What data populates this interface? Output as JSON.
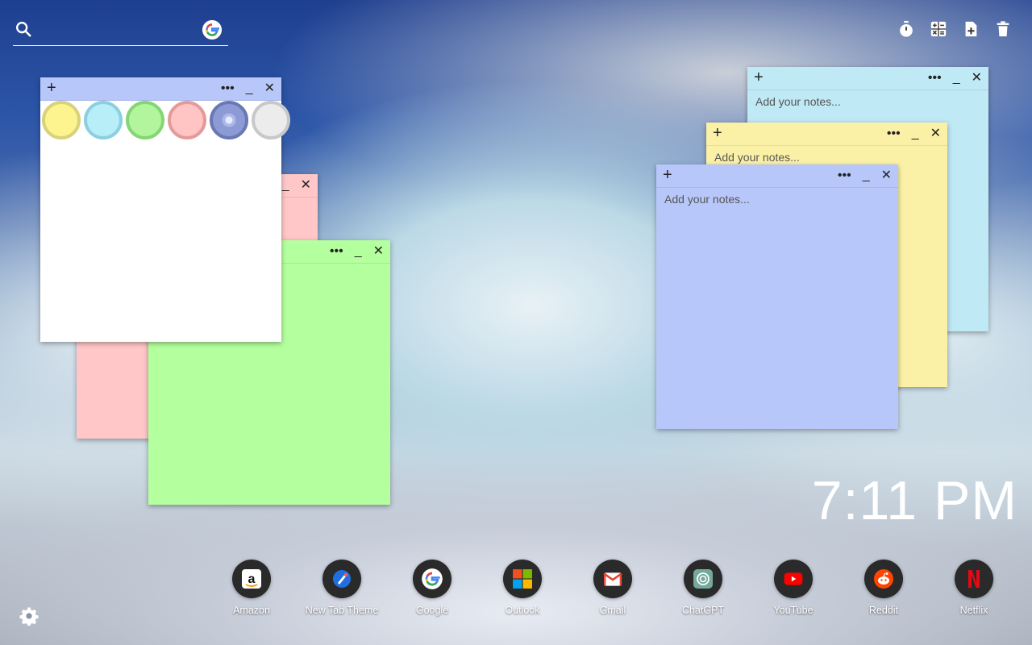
{
  "search": {
    "placeholder": "",
    "icon": "search-icon",
    "engine_icon": "google-icon"
  },
  "toolbar": {
    "buttons": [
      {
        "icon": "stopwatch-icon"
      },
      {
        "icon": "calculator-icon"
      },
      {
        "icon": "add-note-icon"
      },
      {
        "icon": "trash-icon"
      }
    ]
  },
  "notes": [
    {
      "color": "#bfe9f5",
      "placeholder": "Add your notes...",
      "plus": "+",
      "more": "•••",
      "minimize": "_",
      "close": "✕"
    },
    {
      "color": "#fbf1a6",
      "placeholder": "Add your notes...",
      "plus": "+",
      "more": "•••",
      "minimize": "_",
      "close": "✕"
    },
    {
      "color": "#b8c7f9",
      "placeholder": "Add your notes...",
      "plus": "+",
      "more": "•••",
      "minimize": "_",
      "close": "✕"
    },
    {
      "color": "#ffc7c7",
      "plus": "+",
      "more": "•••",
      "minimize": "_",
      "close": "✕"
    },
    {
      "color": "#b4ff9e",
      "plus": "+",
      "more": "•••",
      "minimize": "_",
      "close": "✕"
    },
    {
      "color": "#ffffff",
      "plus": "+",
      "more": "•••",
      "minimize": "_",
      "close": "✕"
    }
  ],
  "palette": [
    {
      "fill": "#fdf48f",
      "border": "#d9d27c"
    },
    {
      "fill": "#b7eef8",
      "border": "#8ccfdf"
    },
    {
      "fill": "#b2f59c",
      "border": "#86d574"
    },
    {
      "fill": "#ffc4c4",
      "border": "#e59a9a"
    },
    {
      "fill": "#8c9ad6",
      "border": "#6a78b4",
      "selected": true
    },
    {
      "fill": "#ececec",
      "border": "#c8c8c8"
    }
  ],
  "clock": {
    "time": "7:11 PM"
  },
  "apps": [
    {
      "label": "Amazon",
      "icon": "amazon-icon"
    },
    {
      "label": "New Tab Theme",
      "icon": "new-tab-theme-icon"
    },
    {
      "label": "Google",
      "icon": "google-icon"
    },
    {
      "label": "Outlook",
      "icon": "outlook-icon"
    },
    {
      "label": "Gmail",
      "icon": "gmail-icon"
    },
    {
      "label": "ChatGPT",
      "icon": "chatgpt-icon"
    },
    {
      "label": "YouTube",
      "icon": "youtube-icon"
    },
    {
      "label": "Reddit",
      "icon": "reddit-icon"
    },
    {
      "label": "Netflix",
      "icon": "netflix-icon"
    }
  ],
  "settings": {
    "icon": "gear-icon"
  }
}
